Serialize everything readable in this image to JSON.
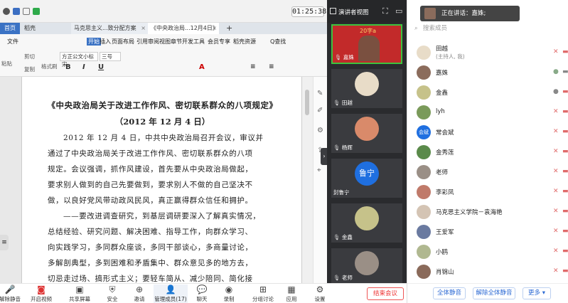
{
  "status": {
    "time": "01:25:38"
  },
  "wps": {
    "tabs": [
      {
        "label": "首页"
      },
      {
        "label": "稻壳"
      },
      {
        "label": "马克思主义...致分配方案"
      },
      {
        "label": "《中央政治局...12月4日》"
      },
      {
        "label": "+"
      }
    ],
    "menu": [
      "文件",
      "开始",
      "插入",
      "页面布局",
      "引用",
      "审阅",
      "视图",
      "章节",
      "开发工具",
      "会员专享",
      "稻壳资源",
      "Q查找"
    ],
    "ribbon": {
      "cut": "剪切",
      "copy": "复制",
      "brush": "格式刷",
      "paste": "粘贴",
      "font_name": "方正公文小标宋",
      "font_size": "三号"
    }
  },
  "document": {
    "title": "《中央政治局关于改进工作作风、密切联系群众的八项规定》",
    "date": "（2012 年 12 月 4 日）",
    "lines": [
      "2012 年 12 月 4 日，中共中央政治局召开会议，审议并",
      "通过了中央政治局关于改进工作作风、密切联系群众的八项",
      "规定。会议强调，抓作风建设，首先要从中央政治局做起，",
      "要求别人做到的自己先要做到，要求别人不做的自己坚决不",
      "做，以良好党风带动政风民风，真正赢得群众信任和拥护。",
      "——要改进调查研究，到基层调研要深入了解真实情况，",
      "总结经验、研究问题、解决困难、指导工作，向群众学习、",
      "向实践学习，多同群众座谈，多同干部谈心，多商量讨论，",
      "多解剖典型，多到困难和矛盾集中、群众意见多的地方去，",
      "切忌走过场、搞形式主义；要轻车简从、减少陪同、简化接"
    ]
  },
  "meeting": {
    "view_mode": "演讲者视图",
    "tiles": [
      {
        "name": "嘉姝",
        "banner": "20字a"
      },
      {
        "name": "田越"
      },
      {
        "name": "杨辉"
      },
      {
        "name": "封鲁宁",
        "avatar_text": "鲁宁",
        "avatar_color": "#1f6fe0"
      },
      {
        "name": "金鑫"
      },
      {
        "name": "老师"
      }
    ],
    "speaking": "正在讲话：嘉姝;",
    "search_placeholder": "搜索成员",
    "participants": [
      {
        "name": "田越",
        "sub": "(主持人, 我)"
      },
      {
        "name": "嘉姝",
        "sub": ""
      },
      {
        "name": "金鑫",
        "sub": ""
      },
      {
        "name": "lyh",
        "sub": ""
      },
      {
        "name": "常会斌",
        "sub": "",
        "avatar_text": "会斌"
      },
      {
        "name": "金秀莲",
        "sub": ""
      },
      {
        "name": "老师",
        "sub": ""
      },
      {
        "name": "李彩凤",
        "sub": ""
      },
      {
        "name": "马克思主义学院－袁海艳",
        "sub": ""
      },
      {
        "name": "王爱军",
        "sub": ""
      },
      {
        "name": "小鸥",
        "sub": ""
      },
      {
        "name": "肖锦山",
        "sub": ""
      }
    ],
    "footer": {
      "mute_all": "全体静音",
      "unmute_all": "解除全体静音",
      "more": "更多 ▾"
    },
    "toolbar": {
      "unmute": "解除静音",
      "video": "开启视频",
      "share": "共享屏幕",
      "security": "安全",
      "invite": "邀请",
      "members": "管理成员(17)",
      "chat": "聊天",
      "record": "录制",
      "breakout": "分组讨论",
      "apps": "应用",
      "settings": "设置",
      "end": "结束会议"
    }
  }
}
